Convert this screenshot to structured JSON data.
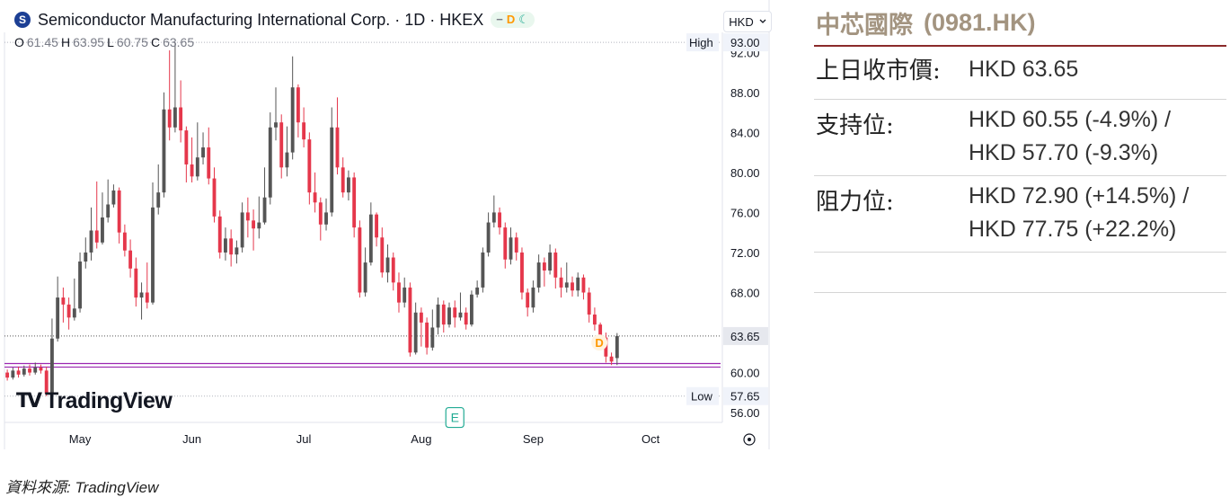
{
  "header": {
    "logo_letter": "S",
    "title": "Semiconductor Manufacturing International Corp. · 1D · HKEX",
    "badge_dash": "−",
    "badge_d": "D",
    "badge_moon": "☾",
    "ohlc": {
      "o_label": "O",
      "o": "61.45",
      "h_label": "H",
      "h": "63.95",
      "l_label": "L",
      "l": "60.75",
      "c_label": "C",
      "c": "63.65"
    },
    "currency": "HKD",
    "currency_icon": "chevron-down-icon"
  },
  "branding": {
    "icon": "TV",
    "text": "TradingView"
  },
  "source": "資料來源: TradingView",
  "colors": {
    "up": "#555555",
    "down": "#e5374b",
    "support_line": "#9c27b0",
    "last_label_bg": "#f0f3fa"
  },
  "info_panel": {
    "name": "中芯國際",
    "code": "(0981.HK)",
    "rows": [
      {
        "label": "上日收市價:",
        "values": [
          "HKD 63.65"
        ]
      },
      {
        "label": "支持位:",
        "values": [
          "HKD 60.55 (-4.9%) /",
          "HKD 57.70 (-9.3%)"
        ]
      },
      {
        "label": "阻力位:",
        "values": [
          "HKD 72.90 (+14.5%) /",
          "HKD 77.75 (+22.2%)"
        ]
      }
    ]
  },
  "chart_data": {
    "type": "candlestick",
    "y_ticks": [
      "56.00",
      "60.00",
      "64.00",
      "68.00",
      "72.00",
      "76.00",
      "80.00",
      "84.00",
      "88.00",
      "92.00"
    ],
    "y_tick_values": [
      56,
      60,
      64,
      68,
      72,
      76,
      80,
      84,
      88,
      92
    ],
    "ylim": [
      55.2,
      94.0
    ],
    "x_ticks": [
      {
        "label": "May",
        "index": 13
      },
      {
        "label": "Jun",
        "index": 33
      },
      {
        "label": "Jul",
        "index": 53
      },
      {
        "label": "Aug",
        "index": 74
      },
      {
        "label": "Sep",
        "index": 94
      },
      {
        "label": "Oct",
        "index": 115
      }
    ],
    "x_range": [
      0,
      128
    ],
    "high_label": "High",
    "high_value": "93.00",
    "low_label": "Low",
    "low_value": "57.65",
    "last_value": "63.65",
    "last_value_num": 63.65,
    "high_num": 93.0,
    "low_num": 57.65,
    "support_lines": [
      60.55,
      60.9
    ],
    "markers": [
      {
        "label": "D",
        "index": 106,
        "value": 63.0
      },
      {
        "label": "E",
        "index": 80,
        "value": 55.6
      }
    ],
    "candles": [
      [
        60.0,
        59.5,
        60.3,
        59.2
      ],
      [
        59.5,
        60.2,
        60.5,
        59.3
      ],
      [
        60.2,
        59.8,
        60.6,
        59.5
      ],
      [
        59.8,
        60.4,
        60.7,
        59.6
      ],
      [
        60.4,
        60.0,
        60.8,
        59.7
      ],
      [
        60.0,
        60.5,
        61.0,
        59.8
      ],
      [
        60.5,
        60.2,
        60.8,
        59.9
      ],
      [
        60.2,
        57.9,
        60.6,
        57.65
      ],
      [
        57.9,
        63.4,
        65.4,
        57.8
      ],
      [
        63.4,
        67.5,
        69.6,
        63.1
      ],
      [
        67.5,
        66.8,
        68.5,
        65.0
      ],
      [
        66.8,
        65.5,
        67.5,
        64.3
      ],
      [
        65.5,
        66.4,
        69.4,
        65.2
      ],
      [
        66.4,
        71.1,
        72.0,
        66.0
      ],
      [
        71.1,
        72.0,
        73.5,
        70.4
      ],
      [
        72.0,
        74.2,
        76.5,
        71.2
      ],
      [
        74.2,
        73.0,
        79.1,
        72.4
      ],
      [
        73.0,
        75.5,
        78.0,
        72.8
      ],
      [
        75.5,
        76.8,
        79.3,
        75.0
      ],
      [
        76.8,
        78.2,
        78.8,
        76.5
      ],
      [
        78.2,
        74.0,
        78.5,
        72.9
      ],
      [
        74.0,
        72.2,
        74.8,
        71.6
      ],
      [
        72.2,
        70.4,
        73.3,
        69.5
      ],
      [
        70.4,
        67.5,
        71.5,
        66.6
      ],
      [
        67.5,
        68.0,
        69.0,
        65.3
      ],
      [
        68.0,
        67.0,
        71.0,
        66.4
      ],
      [
        67.0,
        76.5,
        79.0,
        66.8
      ],
      [
        76.5,
        78.0,
        80.8,
        75.8
      ],
      [
        78.0,
        86.3,
        88.0,
        77.5
      ],
      [
        86.3,
        84.5,
        92.2,
        83.2
      ],
      [
        84.5,
        86.5,
        93.0,
        84.0
      ],
      [
        86.5,
        84.2,
        89.2,
        83.0
      ],
      [
        84.2,
        80.8,
        84.6,
        79.0
      ],
      [
        80.8,
        79.6,
        83.5,
        79.0
      ],
      [
        79.6,
        81.5,
        85.0,
        79.2
      ],
      [
        81.5,
        82.5,
        84.0,
        80.8
      ],
      [
        82.5,
        79.4,
        84.5,
        78.8
      ],
      [
        79.4,
        75.6,
        80.5,
        75.0
      ],
      [
        75.6,
        72.0,
        76.2,
        71.4
      ],
      [
        72.0,
        73.4,
        74.5,
        71.2
      ],
      [
        73.4,
        71.8,
        74.3,
        70.6
      ],
      [
        71.8,
        72.5,
        73.2,
        70.9
      ],
      [
        72.5,
        76.0,
        77.0,
        72.0
      ],
      [
        76.0,
        75.2,
        77.5,
        73.5
      ],
      [
        75.2,
        74.4,
        76.3,
        72.2
      ],
      [
        74.4,
        75.0,
        77.6,
        73.4
      ],
      [
        75.0,
        77.5,
        80.5,
        74.8
      ],
      [
        77.5,
        84.5,
        86.0,
        76.8
      ],
      [
        84.5,
        85.0,
        88.5,
        83.2
      ],
      [
        85.0,
        80.5,
        85.8,
        79.4
      ],
      [
        80.5,
        82.0,
        84.6,
        79.6
      ],
      [
        82.0,
        88.5,
        91.6,
        81.3
      ],
      [
        88.5,
        85.0,
        88.8,
        83.5
      ],
      [
        85.0,
        83.3,
        86.5,
        82.5
      ],
      [
        83.3,
        78.0,
        84.0,
        76.8
      ],
      [
        78.0,
        77.0,
        80.0,
        76.0
      ],
      [
        77.0,
        74.8,
        77.5,
        73.2
      ],
      [
        74.8,
        76.0,
        77.4,
        74.2
      ],
      [
        76.0,
        84.5,
        86.5,
        75.6
      ],
      [
        84.5,
        80.5,
        87.5,
        79.8
      ],
      [
        80.5,
        78.0,
        81.5,
        77.5
      ],
      [
        78.0,
        79.5,
        80.2,
        77.2
      ],
      [
        79.5,
        74.5,
        80.0,
        73.5
      ],
      [
        74.5,
        68.0,
        75.2,
        67.5
      ],
      [
        68.0,
        71.0,
        72.5,
        67.6
      ],
      [
        71.0,
        75.8,
        77.0,
        70.7
      ],
      [
        75.8,
        73.5,
        76.0,
        72.6
      ],
      [
        73.5,
        70.0,
        74.5,
        69.5
      ],
      [
        70.0,
        71.5,
        72.8,
        69.0
      ],
      [
        71.5,
        69.0,
        72.0,
        68.2
      ],
      [
        69.0,
        67.0,
        70.0,
        66.0
      ],
      [
        67.0,
        68.5,
        69.5,
        66.5
      ],
      [
        68.5,
        62.0,
        69.0,
        61.6
      ],
      [
        62.0,
        66.0,
        67.0,
        61.8
      ],
      [
        66.0,
        65.0,
        66.5,
        62.6
      ],
      [
        65.0,
        62.5,
        65.5,
        61.8
      ],
      [
        62.5,
        64.5,
        66.3,
        62.2
      ],
      [
        64.5,
        66.8,
        67.5,
        63.8
      ],
      [
        66.8,
        64.8,
        67.2,
        64.0
      ],
      [
        64.8,
        66.5,
        67.0,
        64.5
      ],
      [
        66.5,
        65.5,
        67.2,
        64.5
      ],
      [
        65.5,
        66.0,
        68.0,
        65.2
      ],
      [
        66.0,
        64.8,
        66.5,
        64.3
      ],
      [
        64.8,
        67.8,
        68.2,
        64.6
      ],
      [
        67.8,
        68.5,
        69.2,
        67.5
      ],
      [
        68.5,
        72.0,
        72.5,
        68.0
      ],
      [
        72.0,
        75.0,
        76.0,
        71.6
      ],
      [
        75.0,
        76.0,
        77.7,
        74.5
      ],
      [
        76.0,
        74.5,
        76.5,
        73.8
      ],
      [
        74.5,
        71.3,
        75.0,
        70.4
      ],
      [
        71.3,
        73.5,
        74.5,
        70.8
      ],
      [
        73.5,
        72.0,
        74.0,
        71.2
      ],
      [
        72.0,
        68.0,
        72.5,
        67.3
      ],
      [
        68.0,
        66.5,
        68.4,
        65.6
      ],
      [
        66.5,
        68.5,
        69.2,
        66.0
      ],
      [
        68.5,
        71.0,
        71.8,
        68.0
      ],
      [
        71.0,
        70.2,
        71.5,
        68.6
      ],
      [
        70.2,
        72.0,
        72.8,
        69.8
      ],
      [
        72.0,
        69.5,
        72.4,
        68.4
      ],
      [
        69.5,
        68.5,
        70.5,
        67.5
      ],
      [
        68.5,
        69.0,
        71.0,
        68.0
      ],
      [
        69.0,
        68.2,
        69.6,
        67.6
      ],
      [
        68.2,
        69.5,
        70.0,
        67.6
      ],
      [
        69.5,
        68.0,
        69.8,
        67.3
      ],
      [
        68.0,
        65.8,
        68.5,
        65.0
      ],
      [
        65.8,
        64.8,
        66.5,
        64.2
      ],
      [
        64.8,
        63.5,
        65.0,
        62.8
      ],
      [
        63.5,
        61.6,
        64.0,
        61.0
      ],
      [
        61.6,
        61.1,
        62.0,
        60.75
      ],
      [
        61.45,
        63.65,
        63.95,
        60.75
      ]
    ]
  }
}
